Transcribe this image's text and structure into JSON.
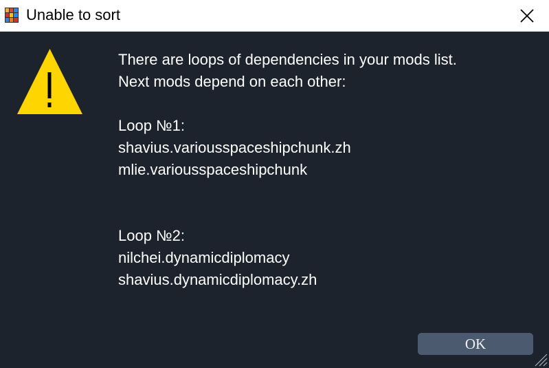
{
  "window": {
    "title": "Unable to sort"
  },
  "dialog": {
    "message": "There are loops of dependencies in your mods list.\nNext mods depend on each other:\n\nLoop №1:\nshavius.variousspaceshipchunk.zh\nmlie.variousspaceshipchunk\n\n\nLoop №2:\nnilchei.dynamicdiplomacy\nshavius.dynamicdiplomacy.zh",
    "ok_label": "OK"
  },
  "icons": {
    "app": "app-grid-icon",
    "close": "close-icon",
    "warning": "warning-icon",
    "resize": "resize-grip-icon"
  },
  "colors": {
    "background": "#1c232d",
    "titlebar": "#ffffff",
    "button": "#4b5a6e",
    "warning": "#ffd500"
  }
}
